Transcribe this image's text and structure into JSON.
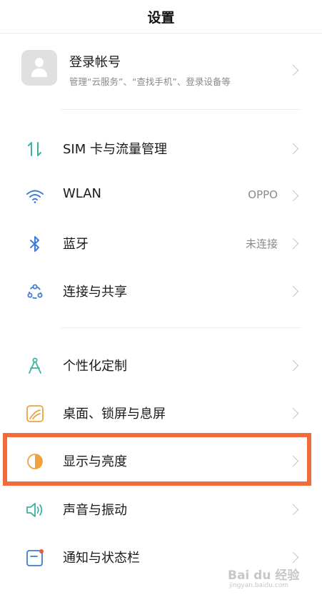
{
  "header": {
    "title": "设置"
  },
  "account": {
    "title": "登录帐号",
    "subtitle": "管理“云服务”、“查找手机”、登录设备等"
  },
  "rows": [
    {
      "label": "SIM 卡与流量管理",
      "value": "",
      "icon": "sim-data-icon"
    },
    {
      "label": "WLAN",
      "value": "OPPO",
      "icon": "wifi-icon"
    },
    {
      "label": "蓝牙",
      "value": "未连接",
      "icon": "bluetooth-icon"
    },
    {
      "label": "连接与共享",
      "value": "",
      "icon": "connection-share-icon"
    },
    {
      "label": "个性化定制",
      "value": "",
      "icon": "personalize-icon"
    },
    {
      "label": "桌面、锁屏与息屏",
      "value": "",
      "icon": "wallpaper-icon"
    },
    {
      "label": "显示与亮度",
      "value": "",
      "icon": "display-brightness-icon"
    },
    {
      "label": "声音与振动",
      "value": "",
      "icon": "sound-icon"
    },
    {
      "label": "通知与状态栏",
      "value": "",
      "icon": "notification-icon"
    }
  ],
  "watermark": {
    "text": "Bai du 经验",
    "sub": "jingyan.baidu.com"
  },
  "colors": {
    "highlight": "#f26b3a",
    "icon_green": "#3bb3a0",
    "icon_blue": "#3d7bd9",
    "icon_orange": "#f0a23c",
    "icon_red": "#e8584a"
  }
}
